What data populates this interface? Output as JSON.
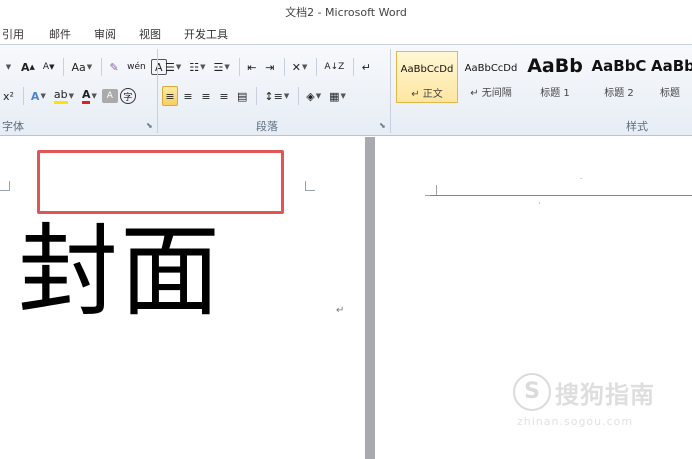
{
  "window": {
    "title": "文档2 - Microsoft Word"
  },
  "tabs": [
    {
      "label": "引用"
    },
    {
      "label": "邮件"
    },
    {
      "label": "审阅"
    },
    {
      "label": "视图"
    },
    {
      "label": "开发工具"
    }
  ],
  "ribbon": {
    "font_group": {
      "label": "字体",
      "grow_font": "A",
      "shrink_font": "A",
      "change_case": "Aa",
      "phonetic": "wén",
      "char_border": "A",
      "superscript": "x²",
      "text_effect": "A",
      "highlight": "ab",
      "font_color": "A",
      "char_shading": "A",
      "enclose_char": "字"
    },
    "paragraph_group": {
      "label": "段落",
      "sort": "A↓Z",
      "show_marks": "↵"
    },
    "styles_group": {
      "label": "样式",
      "items": [
        {
          "preview": "AaBbCcDd",
          "name": "↵ 正文",
          "selected": true
        },
        {
          "preview": "AaBbCcDd",
          "name": "↵ 无间隔",
          "selected": false
        },
        {
          "preview": "AaBb",
          "name": "标题 1",
          "selected": false
        },
        {
          "preview": "AaBbC",
          "name": "标题 2",
          "selected": false
        },
        {
          "preview": "AaBb",
          "name": "标题",
          "selected": false
        }
      ]
    }
  },
  "document": {
    "cover_text": "封面",
    "paragraph_mark": "↵",
    "small_mark": "·"
  },
  "watermark": {
    "logo": "S",
    "text": "搜狗指南",
    "url": "zhinan.sogou.com"
  },
  "colors": {
    "highlight_box": "#e05555",
    "selected_style": "#fde6a0"
  }
}
